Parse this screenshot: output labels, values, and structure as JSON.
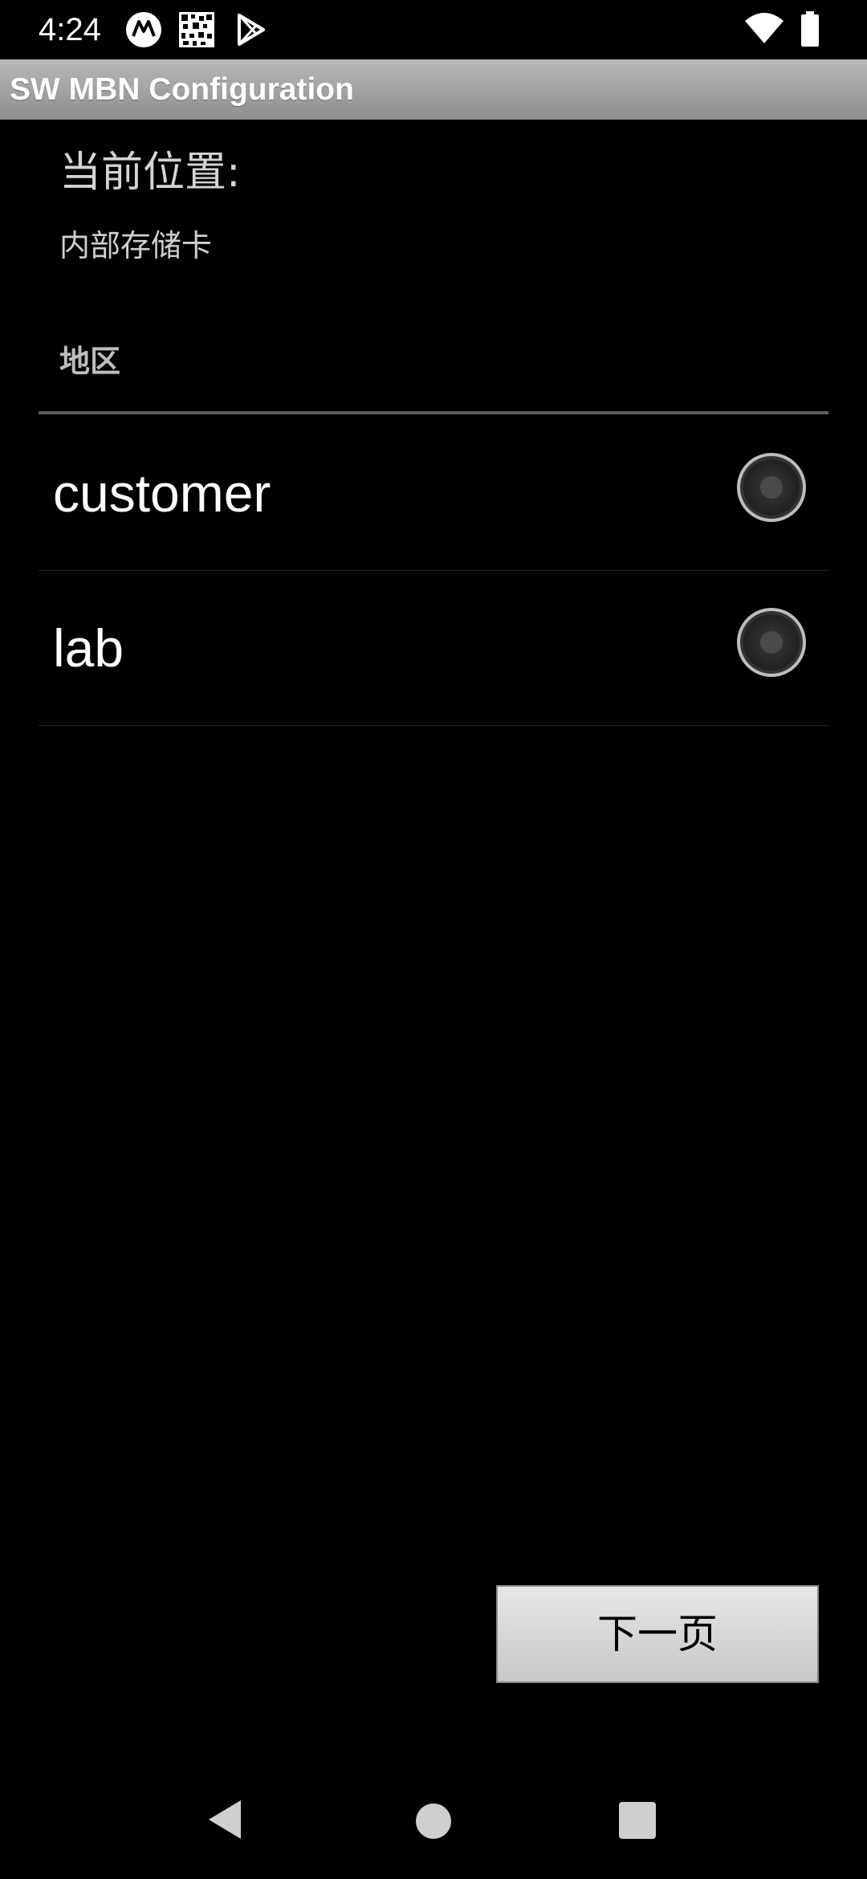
{
  "status_bar": {
    "time": "4:24",
    "icons": [
      "motorola-icon",
      "qr-code-icon",
      "play-store-icon",
      "wifi-icon",
      "battery-icon"
    ]
  },
  "app": {
    "title": "SW MBN Configuration"
  },
  "location": {
    "label": "当前位置:",
    "value": "内部存储卡"
  },
  "region": {
    "header": "地区",
    "options": [
      {
        "label": "customer",
        "selected": false
      },
      {
        "label": "lab",
        "selected": false
      }
    ]
  },
  "actions": {
    "next_label": "下一页"
  },
  "nav_bar": {
    "icons": [
      "back-icon",
      "home-icon",
      "recents-icon"
    ]
  },
  "colors": {
    "background": "#000000",
    "title_bar": "#a8a8a8",
    "button": "#d6d6d6"
  }
}
